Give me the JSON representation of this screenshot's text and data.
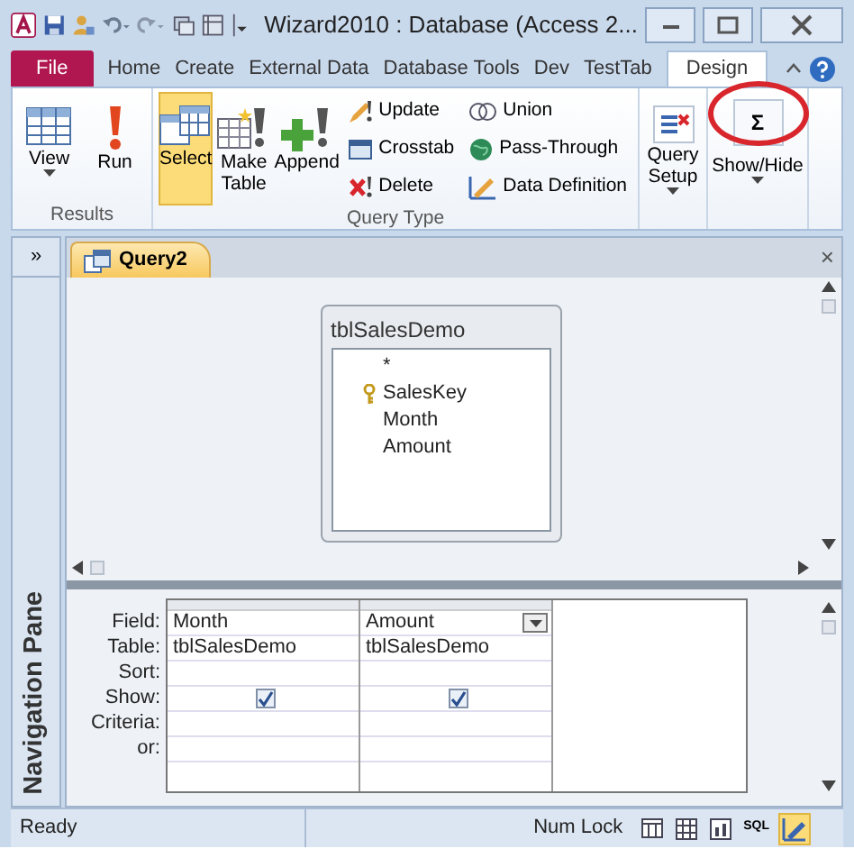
{
  "title_bar": {
    "title": "Wizard2010 : Database (Access 2..."
  },
  "ribbon_tabs": [
    {
      "label": "File",
      "kind": "file",
      "selected": false
    },
    {
      "label": "Home",
      "kind": "tab",
      "selected": false
    },
    {
      "label": "Create",
      "kind": "tab",
      "selected": false
    },
    {
      "label": "External Data",
      "kind": "tab",
      "selected": false
    },
    {
      "label": "Database Tools",
      "kind": "tab",
      "selected": false
    },
    {
      "label": "Dev",
      "kind": "tab",
      "selected": false
    },
    {
      "label": "TestTab",
      "kind": "tab",
      "selected": false
    },
    {
      "label": "Design",
      "kind": "tab",
      "selected": true
    }
  ],
  "ribbon_groups": [
    {
      "label": "Results",
      "buttons": [
        {
          "label": "View",
          "kind": "large",
          "selected": false,
          "dropdown": true
        },
        {
          "label": "Run",
          "kind": "large",
          "selected": false,
          "dropdown": false
        }
      ]
    },
    {
      "label": "Query Type",
      "buttons": [
        {
          "label": "Select",
          "kind": "large",
          "selected": true,
          "dropdown": false
        },
        {
          "label": "Make Table",
          "kind": "large",
          "selected": false,
          "dropdown": false
        },
        {
          "label": "Append",
          "kind": "large",
          "selected": false,
          "dropdown": false
        },
        {
          "label": "Update",
          "kind": "small",
          "selected": false,
          "dropdown": false
        },
        {
          "label": "Crosstab",
          "kind": "small",
          "selected": false,
          "dropdown": false
        },
        {
          "label": "Delete",
          "kind": "small",
          "selected": false,
          "dropdown": false
        },
        {
          "label": "Union",
          "kind": "small",
          "selected": false,
          "dropdown": false
        },
        {
          "label": "Pass-Through",
          "kind": "small",
          "selected": false,
          "dropdown": false
        },
        {
          "label": "Data Definition",
          "kind": "small",
          "selected": false,
          "dropdown": false
        }
      ]
    },
    {
      "buttons": [
        {
          "label": "Query Setup",
          "kind": "large",
          "selected": false,
          "dropdown": true
        }
      ]
    },
    {
      "buttons": [
        {
          "label": "Σ",
          "kind": "symbol",
          "selected": false,
          "dropdown": false,
          "circled": true
        },
        {
          "label": "Show/Hide",
          "kind": "text",
          "selected": false,
          "dropdown": true
        }
      ]
    }
  ],
  "navigation_pane": {
    "toggle": "»",
    "label": "Navigation Pane",
    "expanded": false
  },
  "document_tab": {
    "label": "Query2",
    "close": "×",
    "selected": true
  },
  "table_box": {
    "title": "tblSalesDemo",
    "fields": [
      {
        "name": "*",
        "primary_key": false
      },
      {
        "name": "SalesKey",
        "primary_key": true
      },
      {
        "name": "Month",
        "primary_key": false
      },
      {
        "name": "Amount",
        "primary_key": false
      }
    ]
  },
  "design_grid": {
    "row_labels": [
      "Field:",
      "Table:",
      "Sort:",
      "Show:",
      "Criteria:",
      "or:"
    ],
    "columns": [
      {
        "field": "Month",
        "table": "tblSalesDemo",
        "show": true,
        "active": false
      },
      {
        "field": "Amount",
        "table": "tblSalesDemo",
        "show": true,
        "active": true
      }
    ]
  },
  "status_bar": {
    "text": "Ready",
    "num_lock": "Num Lock",
    "views": [
      {
        "kind": "datasheet",
        "selected": false
      },
      {
        "kind": "pivottable",
        "selected": false
      },
      {
        "kind": "pivotchart",
        "selected": false
      },
      {
        "kind": "sql",
        "label": "SQL",
        "selected": false
      },
      {
        "kind": "design",
        "selected": true
      }
    ]
  }
}
